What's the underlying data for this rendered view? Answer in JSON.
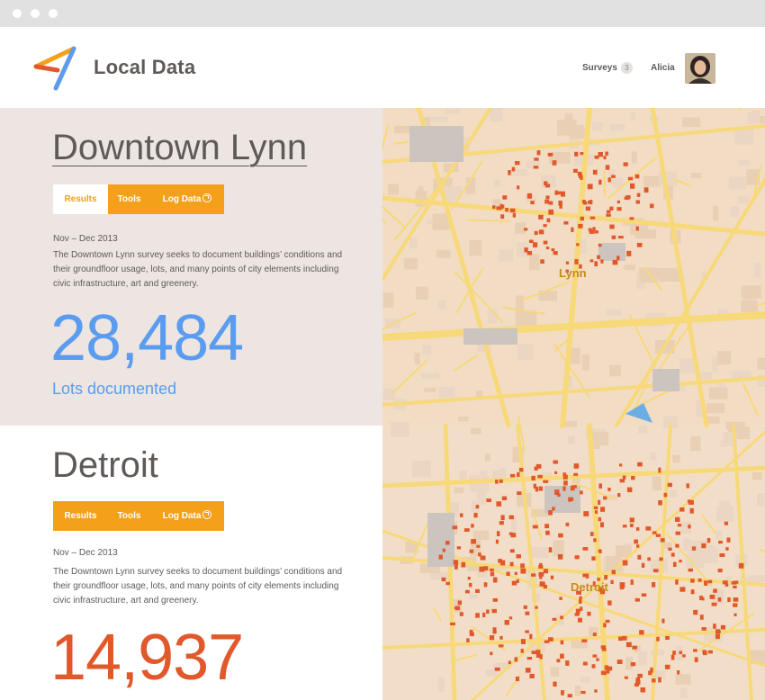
{
  "app": {
    "brand": "Local Data"
  },
  "nav": {
    "surveys_label": "Surveys",
    "surveys_count": "3",
    "user_name": "Alicia"
  },
  "colors": {
    "accent_orange": "#f5a01a",
    "blue": "#5a9cf0",
    "red": "#e1582a",
    "panel_bg": "#ede5e1"
  },
  "icons": {
    "logo": "local-data-logo",
    "log_data": "arrow-circle-icon"
  },
  "surveys": [
    {
      "title": "Downtown Lynn",
      "tabs": {
        "results": "Results",
        "tools": "Tools",
        "log_data": "Log Data"
      },
      "date": "Nov – Dec 2013",
      "description": "The Downtown Lynn survey seeks to document buildings’ conditions and their groundfloor usage, lots, and many points of city elements including civic infrastructure, art and greenery.",
      "count": "28,484",
      "count_label": "Lots documented"
    },
    {
      "title": "Detroit",
      "tabs": {
        "results": "Results",
        "tools": "Tools",
        "log_data": "Log Data"
      },
      "date": "Nov – Dec 2013",
      "description": "The Downtown Lynn survey seeks to document buildings’ conditions and their groundfloor usage, lots, and many points of city elements including civic infrastructure, art and greenery.",
      "count": "14,937"
    }
  ],
  "map": {
    "label_lynn": "Lynn",
    "label_detroit": "Detroit"
  }
}
